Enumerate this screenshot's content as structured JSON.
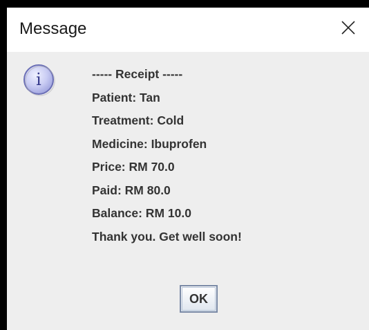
{
  "window": {
    "title": "Message",
    "close_icon": "close-icon"
  },
  "dialog": {
    "icon": "info-icon",
    "icon_glyph": "i",
    "lines": [
      "----- Receipt -----",
      "Patient: Tan",
      "Treatment: Cold",
      "Medicine: Ibuprofen",
      "Price: RM 70.0",
      "Paid: RM 80.0",
      "Balance: RM 10.0",
      "Thank you. Get well soon!"
    ],
    "ok_label": "OK"
  },
  "colors": {
    "background": "#eeeeee",
    "titlebar": "#ffffff",
    "text": "#333333",
    "icon_fill": "#c9ccf3",
    "icon_border": "#6b6fb5"
  }
}
